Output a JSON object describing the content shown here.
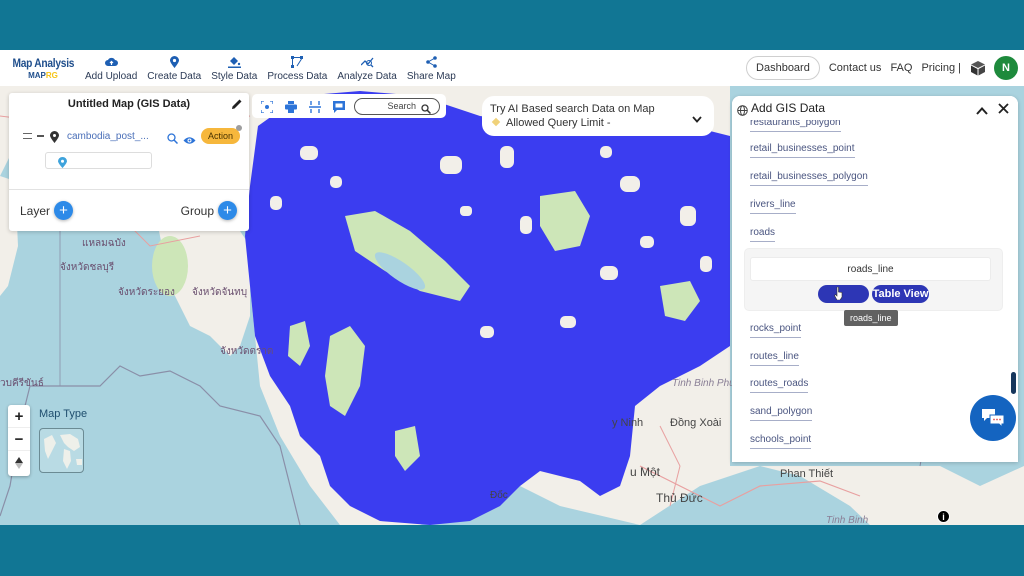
{
  "header": {
    "logo_title": "Map Analysis",
    "logo_sub_a": "MAP",
    "logo_sub_b": "RG",
    "nav": [
      {
        "label": "Add Upload",
        "icon": "cloud-upload-icon"
      },
      {
        "label": "Create Data",
        "icon": "map-pin-icon"
      },
      {
        "label": "Style Data",
        "icon": "paint-bucket-icon"
      },
      {
        "label": "Process Data",
        "icon": "process-nodes-icon"
      },
      {
        "label": "Analyze Data",
        "icon": "analyze-chart-icon"
      },
      {
        "label": "Share Map",
        "icon": "share-icon"
      }
    ],
    "dashboard_label": "Dashboard",
    "contact_label": "Contact us",
    "faq_label": "FAQ",
    "pricing_label": "Pricing |",
    "avatar_initial": "N",
    "colors": {
      "brand": "#1f4e8c",
      "avatar": "#1e8a3c",
      "frame": "#117694"
    }
  },
  "layer_panel": {
    "title": "Untitled Map (GIS Data)",
    "layer": {
      "name": "cambodia_post_...",
      "action_label": "Action"
    },
    "layer_button": "Layer",
    "group_button": "Group"
  },
  "map_toolbar": {
    "search_placeholder": "Search",
    "icons": [
      "focus-icon",
      "print-icon",
      "measure-icon",
      "comment-icon"
    ]
  },
  "ai_search": {
    "line1": "Try AI Based search Data on Map",
    "line2": "Allowed Query Limit -"
  },
  "gis_panel": {
    "title": "Add GIS Data",
    "items_above": [
      "restaurants_polygon",
      "retail_businesses_point",
      "retail_businesses_polygon",
      "rivers_line",
      "roads"
    ],
    "expanded": {
      "name": "roads_line",
      "table_view_label": "Table View",
      "tooltip": "roads_line"
    },
    "items_below": [
      "rocks_point",
      "routes_line",
      "routes_roads",
      "sand_polygon",
      "schools_point"
    ]
  },
  "map": {
    "map_type_label": "Map Type",
    "overlay_color": "#3b3df0",
    "labels": [
      {
        "text": "แหลมฉบัง"
      },
      {
        "text": "จังหวัดชลบุรี"
      },
      {
        "text": "จังหวัดระยอง"
      },
      {
        "text": "จังหวัดจันทบุ"
      },
      {
        "text": "จังหวัดตราด"
      },
      {
        "text": "วบคีรีขันธ์"
      },
      {
        "text": "Tinh Binh Phước"
      },
      {
        "text": "Đồng Xoài"
      },
      {
        "text": "y Ninh"
      },
      {
        "text": "u Một"
      },
      {
        "text": "Thủ Đức"
      },
      {
        "text": "Phan Thiết"
      },
      {
        "text": "Tinh Binh"
      },
      {
        "text": "Đốc"
      }
    ]
  },
  "chat": {
    "icon": "chat-bubbles-icon"
  },
  "info": {
    "symbol": "i"
  }
}
